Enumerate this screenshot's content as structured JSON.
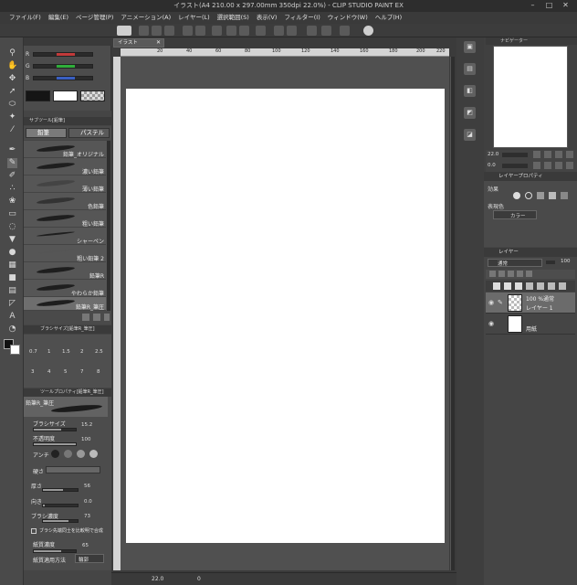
{
  "window": {
    "title": "イラスト(A4 210.00 x 297.00mm 350dpi 22.0%) - CLIP STUDIO PAINT EX"
  },
  "menu": [
    "ファイル(F)",
    "編集(E)",
    "ページ管理(P)",
    "アニメーション(A)",
    "レイヤー(L)",
    "選択範囲(S)",
    "表示(V)",
    "フィルター(I)",
    "ウィンドウ(W)",
    "ヘルプ(H)"
  ],
  "color_panel": {
    "channels": [
      {
        "label": "R",
        "value": "",
        "color": "#c23a3a"
      },
      {
        "label": "G",
        "value": "",
        "color": "#2fae3a"
      },
      {
        "label": "B",
        "value": "",
        "color": "#3a5fc2"
      }
    ]
  },
  "subtool": {
    "header": "サブツール[鉛筆]",
    "tabs": [
      "鉛筆",
      "パステル"
    ],
    "brushes": [
      {
        "name": "鉛筆_オリジナル"
      },
      {
        "name": "濃い鉛筆"
      },
      {
        "name": "薄い鉛筆"
      },
      {
        "name": "色鉛筆"
      },
      {
        "name": "粗い鉛筆"
      },
      {
        "name": "シャーペン"
      },
      {
        "name": "粗い鉛筆 2"
      },
      {
        "name": "鉛筆R"
      },
      {
        "name": "やわらか鉛筆"
      },
      {
        "name": "鉛筆R_筆圧"
      }
    ],
    "selected_index": 9
  },
  "brush_size": {
    "header": "ブラシサイズ[鉛筆R_筆圧]",
    "row1": [
      "0.7",
      "1",
      "1.5",
      "2",
      "2.5"
    ],
    "row2": [
      "3",
      "4",
      "5",
      "7",
      "8"
    ]
  },
  "tool_property": {
    "header": "ツールプロパティ[鉛筆R_筆圧]",
    "preset_name": "鉛筆R_筆圧",
    "brush_size_label": "ブラシサイズ",
    "brush_size_value": "15.2",
    "opacity_label": "不透明度",
    "opacity_value": "100",
    "antialias_label": "アンチ",
    "hardness_label": "硬さ",
    "thickness_label": "厚さ",
    "thickness_value": "56",
    "direction_label": "向き",
    "direction_value": "0.0",
    "density_label": "ブラシ濃度",
    "density_value": "73",
    "blend_label": "ブラシ先端同士を比較明で合成",
    "paper_label": "紙質濃度",
    "paper_value": "65",
    "paper_method_label": "紙質適用方法",
    "paper_method_value": "輪郭"
  },
  "canvas": {
    "tab_label": "イラスト",
    "ruler_ticks": [
      "20",
      "40",
      "60",
      "80",
      "100",
      "120",
      "140",
      "160",
      "180",
      "200",
      "220"
    ]
  },
  "status": {
    "zoom": "22.0",
    "angle": "0"
  },
  "navigator": {
    "header": "ナビゲーター",
    "zoom": "22.0",
    "angle": "0.0"
  },
  "layer_property": {
    "header": "レイヤープロパティ",
    "effect_label": "効果",
    "expression_label": "表現色",
    "expression_value": "カラー"
  },
  "layers": {
    "header": "レイヤー",
    "blend_mode": "通常",
    "opacity": "100",
    "items": [
      {
        "line1": "100 %通常",
        "line2": "レイヤー 1"
      },
      {
        "line1": "",
        "line2": "用紙"
      }
    ]
  }
}
